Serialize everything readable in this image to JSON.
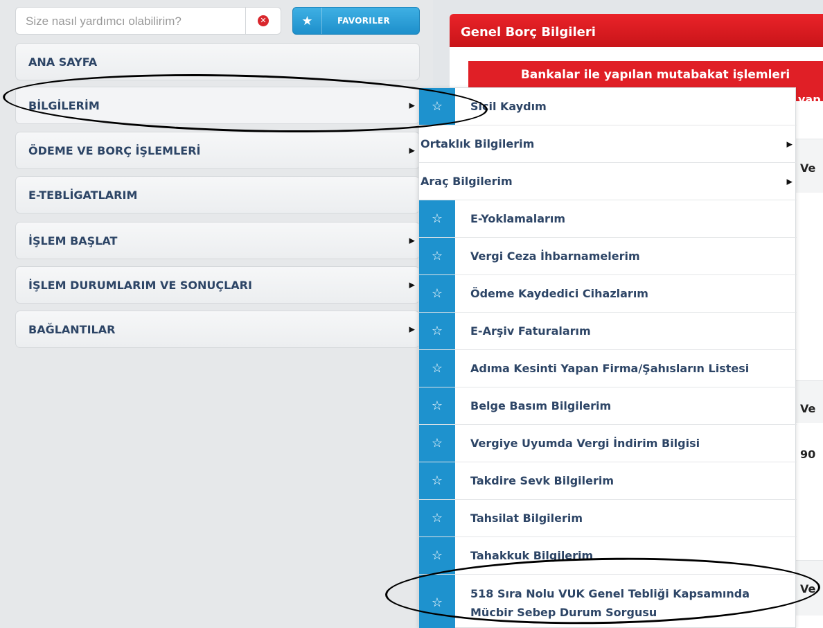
{
  "search": {
    "placeholder": "Size nasıl yardımcı olabilirim?",
    "clear_icon": "x-circle-icon",
    "favorites_label": "FAVORILER",
    "favorites_icon": "star-icon"
  },
  "sidebar": {
    "items": [
      {
        "label": "ANA SAYFA",
        "has_submenu": false
      },
      {
        "label": "BİLGİLERİM",
        "has_submenu": true
      },
      {
        "label": "ÖDEME VE BORÇ İŞLEMLERİ",
        "has_submenu": true
      },
      {
        "label": "E-TEBLİGATLARIM",
        "has_submenu": false
      },
      {
        "label": "İŞLEM BAŞLAT",
        "has_submenu": true
      },
      {
        "label": "İŞLEM DURUMLARIM VE SONUÇLARI",
        "has_submenu": true
      },
      {
        "label": "BAĞLANTILAR",
        "has_submenu": true
      }
    ]
  },
  "content": {
    "header": "Genel Borç Bilgileri",
    "alert": "Bankalar ile yapılan mutabakat işlemleri",
    "alert_cont": "yap",
    "partial_labels": [
      "Ve",
      "Ve",
      "90",
      "Ve"
    ]
  },
  "submenu": {
    "items": [
      {
        "label": "Sicil Kaydım",
        "star": true,
        "arrow": false
      },
      {
        "label": "Ortaklık Bilgilerim",
        "star": false,
        "arrow": true
      },
      {
        "label": "Araç Bilgilerim",
        "star": false,
        "arrow": true
      },
      {
        "label": "E-Yoklamalarım",
        "star": true,
        "arrow": false
      },
      {
        "label": "Vergi Ceza İhbarnamelerim",
        "star": true,
        "arrow": false
      },
      {
        "label": "Ödeme Kaydedici Cihazlarım",
        "star": true,
        "arrow": false
      },
      {
        "label": "E-Arşiv Faturalarım",
        "star": true,
        "arrow": false
      },
      {
        "label": "Adıma Kesinti Yapan Firma/Şahısların Listesi",
        "star": true,
        "arrow": false
      },
      {
        "label": "Belge Basım Bilgilerim",
        "star": true,
        "arrow": false
      },
      {
        "label": "Vergiye Uyumda Vergi İndirim Bilgisi",
        "star": true,
        "arrow": false
      },
      {
        "label": "Takdire Sevk Bilgilerim",
        "star": true,
        "arrow": false
      },
      {
        "label": "Tahsilat Bilgilerim",
        "star": true,
        "arrow": false
      },
      {
        "label": "Tahakkuk Bilgilerim",
        "star": true,
        "arrow": false
      },
      {
        "label": "518 Sıra Nolu VUK Genel Tebliği Kapsamında",
        "label2": "Mücbir Sebep Durum Sorgusu",
        "star": true,
        "arrow": false
      }
    ]
  },
  "colors": {
    "accent_blue": "#1e92ce",
    "header_red": "#e01f26",
    "menu_text": "#2d4566"
  }
}
